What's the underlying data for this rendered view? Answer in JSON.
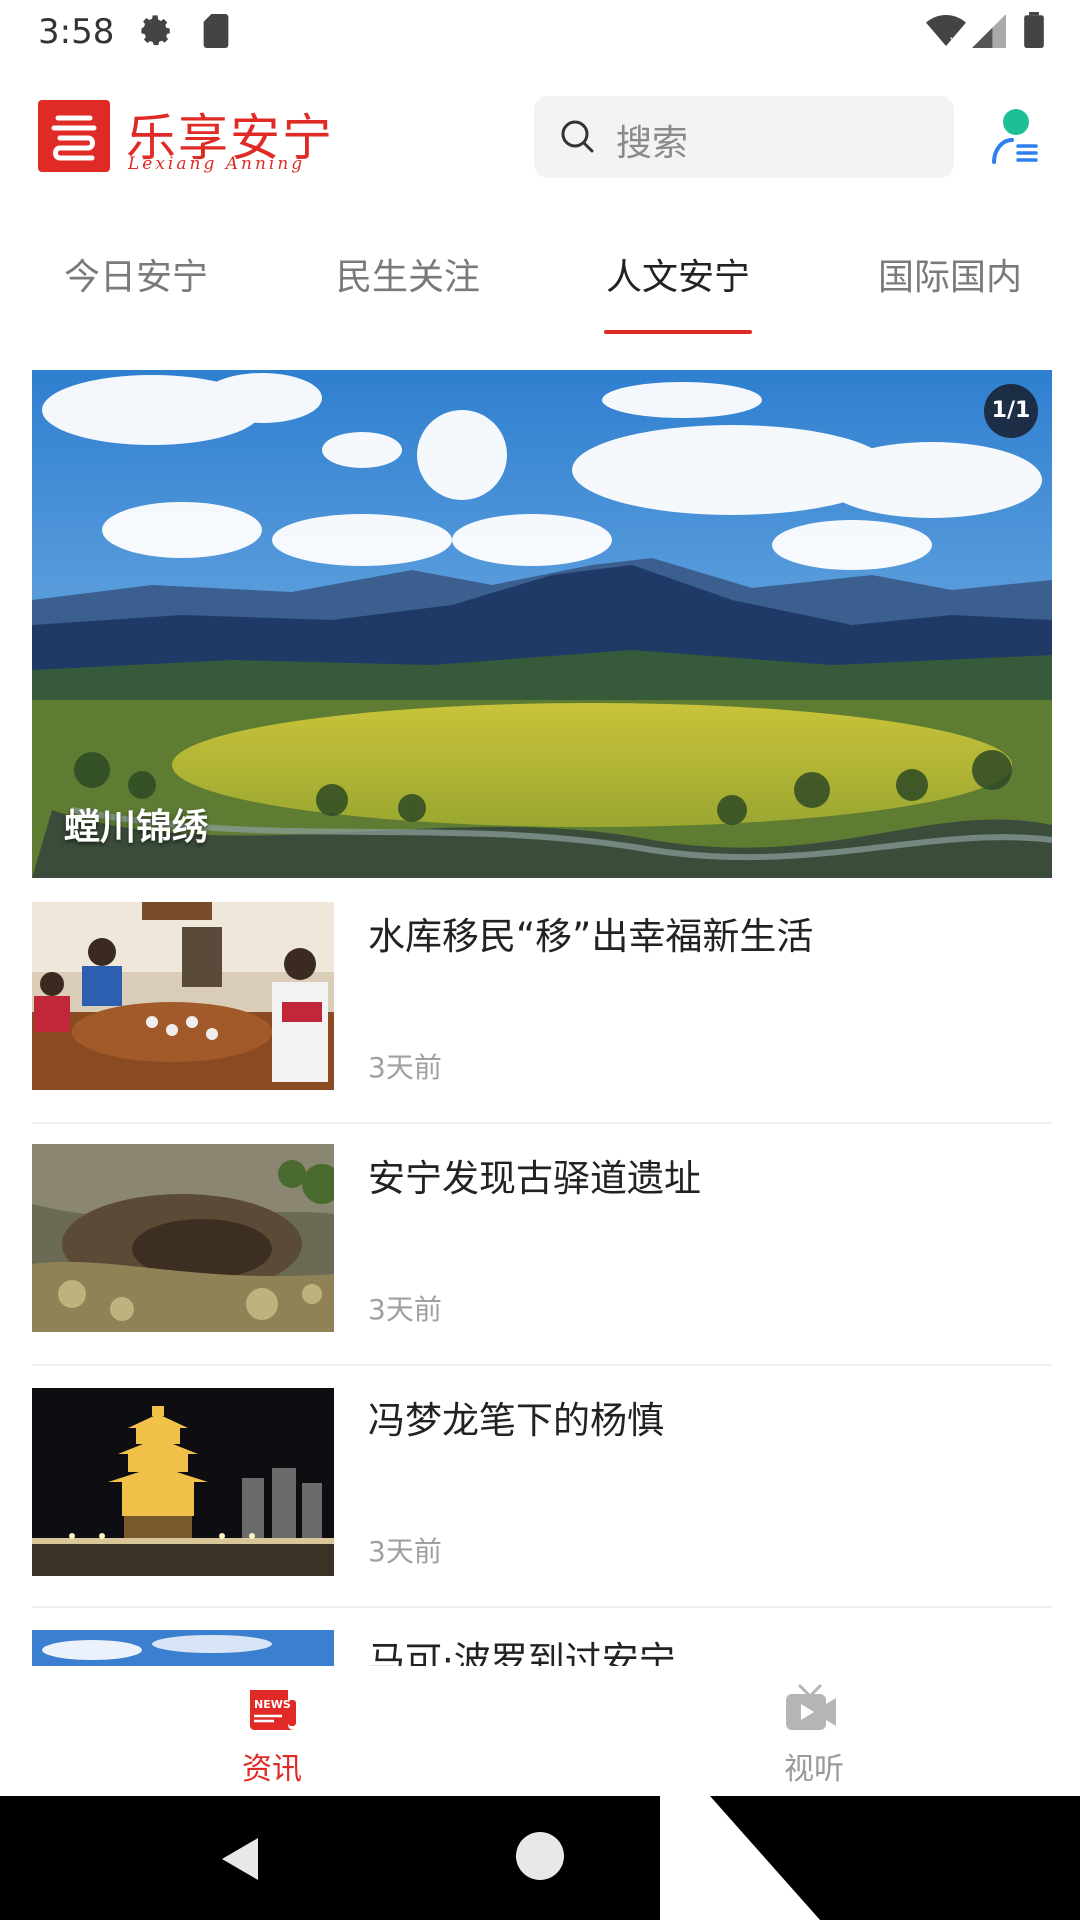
{
  "status_bar": {
    "time": "3:58",
    "icons": [
      "gear-icon",
      "sd-card-icon",
      "wifi-icon",
      "signal-icon",
      "battery-icon"
    ]
  },
  "header": {
    "logo_title": "乐享安宁",
    "logo_subtitle": "Lexiang Anning",
    "search_placeholder": "搜索",
    "brand_color": "#e02a26"
  },
  "tabs": [
    {
      "label": "今日安宁",
      "active": false
    },
    {
      "label": "民生关注",
      "active": false
    },
    {
      "label": "人文安宁",
      "active": true
    },
    {
      "label": "国际国内",
      "active": false
    }
  ],
  "banner": {
    "caption": "螳川锦绣",
    "counter": "1/1"
  },
  "news": [
    {
      "title": "水库移民“移”出幸福新生活",
      "time": "3天前"
    },
    {
      "title": "安宁发现古驿道遗址",
      "time": "3天前"
    },
    {
      "title": "冯梦龙笔下的杨慎",
      "time": "3天前"
    },
    {
      "title": "马可·波罗到过安宁",
      "time": ""
    }
  ],
  "bottom_nav": {
    "news_label": "资讯",
    "video_label": "视听",
    "active": "news"
  }
}
